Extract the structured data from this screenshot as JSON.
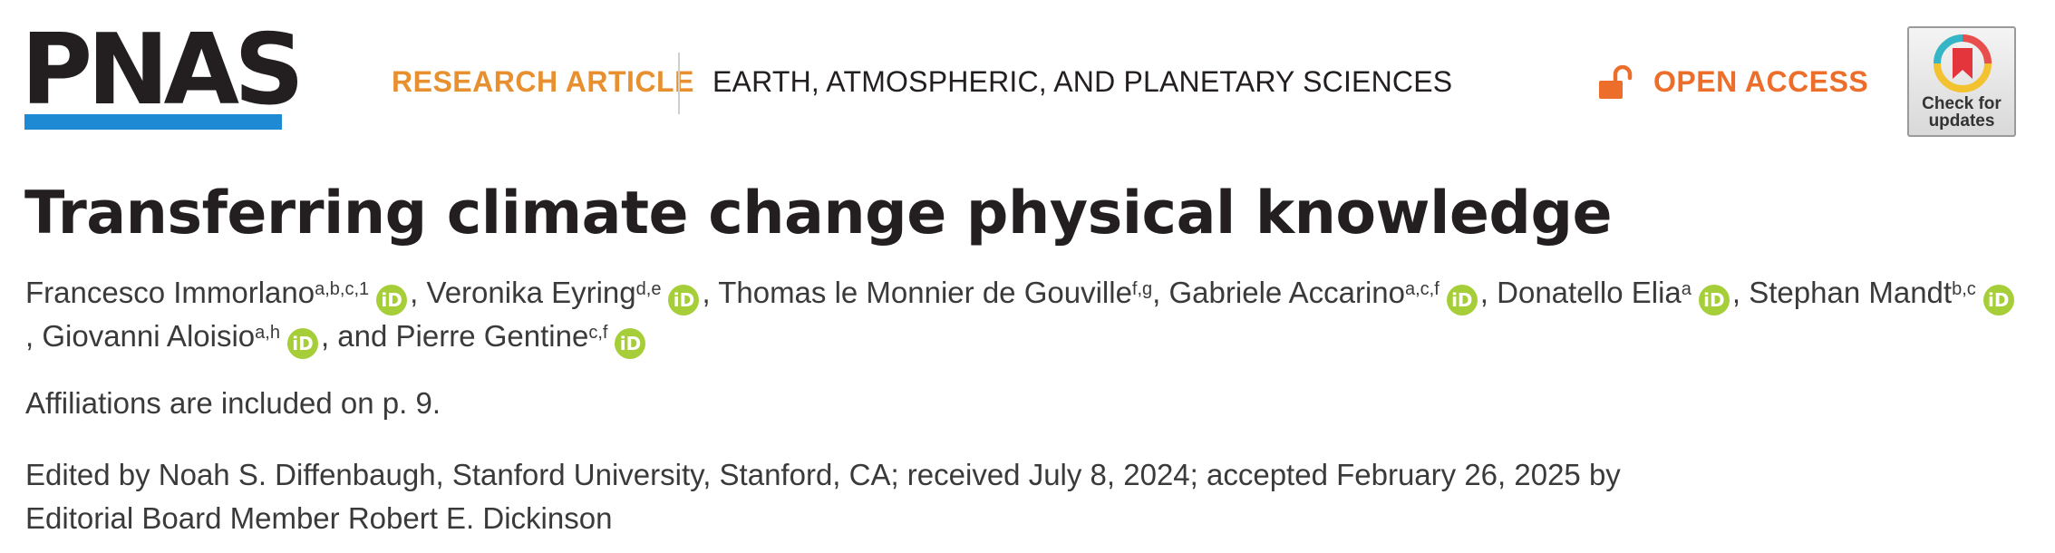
{
  "header": {
    "logo_text": "PNAS",
    "article_type": "RESEARCH ARTICLE",
    "section": "EARTH, ATMOSPHERIC, AND PLANETARY SCIENCES",
    "open_access": "OPEN ACCESS",
    "check_updates_line1": "Check for",
    "check_updates_line2": "updates"
  },
  "colors": {
    "brand_blue": "#1d8ad3",
    "article_type_orange": "#e8902f",
    "open_access_orange": "#ec6e2a",
    "orcid_green": "#a6ce39"
  },
  "article": {
    "title": "Transferring climate change physical knowledge",
    "orcid_glyph": "iD",
    "authors": [
      {
        "name": "Francesco Immorlano",
        "sup": "a,b,c,1",
        "sep": ","
      },
      {
        "name": "Veronika Eyring",
        "sup": "d,e",
        "sep": ","
      },
      {
        "name": "Thomas le Monnier de Gouville",
        "sup": "f,g",
        "sep": ","
      },
      {
        "name": "Gabriele Accarino",
        "sup": "a,c,f",
        "sep": ","
      },
      {
        "name": "Donatello Elia",
        "sup": "a",
        "sep": ","
      },
      {
        "name": "Stephan Mandt",
        "sup": "b,c",
        "sep": ","
      },
      {
        "name": "Giovanni Aloisio",
        "sup": "a,h",
        "sep": ", and"
      },
      {
        "name": "Pierre Gentine",
        "sup": "c,f",
        "sep": ""
      }
    ],
    "affiliations_note": "Affiliations are included on p. 9.",
    "edited_line1": "Edited by Noah S. Diffenbaugh, Stanford University, Stanford, CA; received July 8, 2024; accepted February 26, 2025 by",
    "edited_line2": "Editorial Board Member Robert E. Dickinson"
  }
}
